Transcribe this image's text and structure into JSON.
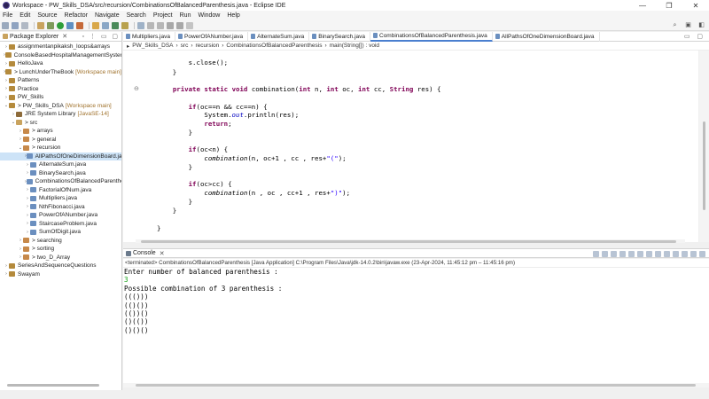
{
  "window": {
    "title": "Workspace - PW_Skills_DSA/src/recursion/CombinationsOfBalancedParenthesis.java - Eclipse IDE",
    "controls": [
      "—",
      "❐",
      "✕"
    ]
  },
  "menu": [
    "File",
    "Edit",
    "Source",
    "Refactor",
    "Navigate",
    "Search",
    "Project",
    "Run",
    "Window",
    "Help"
  ],
  "explorer": {
    "tab_label": "Package Explorer",
    "tree": [
      {
        "label": "assignmentanpikaksh_loops&arrays",
        "suffix": "",
        "arrow": "›",
        "icon": "project-icon"
      },
      {
        "label": "ConsoleBasedHospitalManagementSystem",
        "suffix": "",
        "arrow": "›",
        "icon": "project-icon"
      },
      {
        "label": "HelloJava",
        "suffix": "",
        "arrow": "›",
        "icon": "project-icon"
      },
      {
        "label": "> LunchUnderTheBook",
        "suffix": "[Workspace main]",
        "arrow": "›",
        "icon": "project-icon"
      },
      {
        "label": "Patterns",
        "suffix": "",
        "arrow": "›",
        "icon": "project-icon"
      },
      {
        "label": "Practice",
        "suffix": "",
        "arrow": "›",
        "icon": "project-icon"
      },
      {
        "label": "PW_Skills",
        "suffix": "",
        "arrow": "›",
        "icon": "project-icon"
      },
      {
        "label": "> PW_Skills_DSA",
        "suffix": "[Workspace main]",
        "arrow": "⌄",
        "icon": "project-icon"
      },
      {
        "label": "JRE System Library",
        "suffix": "[JavaSE-14]",
        "arrow": "›",
        "icon": "library-icon"
      },
      {
        "label": "> src",
        "suffix": "",
        "arrow": "⌄",
        "icon": "folder-icon"
      },
      {
        "label": "> arrays",
        "suffix": "",
        "arrow": "›",
        "icon": "package-icon"
      },
      {
        "label": "> general",
        "suffix": "",
        "arrow": "›",
        "icon": "package-icon"
      },
      {
        "label": "> recursion",
        "suffix": "",
        "arrow": "⌄",
        "icon": "package-icon"
      },
      {
        "label": "AllPathsOfOneDimensionBoard.ja",
        "suffix": "",
        "arrow": "›",
        "icon": "java-file-icon",
        "selected": true
      },
      {
        "label": "AlternateSum.java",
        "suffix": "",
        "arrow": "›",
        "icon": "java-file-icon"
      },
      {
        "label": "BinarySearch.java",
        "suffix": "",
        "arrow": "›",
        "icon": "java-file-icon"
      },
      {
        "label": "CombinationsOfBalancedParenthe",
        "suffix": "",
        "arrow": "›",
        "icon": "java-file-icon"
      },
      {
        "label": "FactorialOfNum.java",
        "suffix": "",
        "arrow": "›",
        "icon": "java-file-icon"
      },
      {
        "label": "Multipliers.java",
        "suffix": "",
        "arrow": "›",
        "icon": "java-file-icon"
      },
      {
        "label": "NthFibonacci.java",
        "suffix": "",
        "arrow": "›",
        "icon": "java-file-icon"
      },
      {
        "label": "PowerOfANumber.java",
        "suffix": "",
        "arrow": "›",
        "icon": "java-file-icon"
      },
      {
        "label": "StaircaseProblem.java",
        "suffix": "",
        "arrow": "›",
        "icon": "java-file-icon"
      },
      {
        "label": "SumOfDigit.java",
        "suffix": "",
        "arrow": "›",
        "icon": "java-file-icon"
      },
      {
        "label": "> searching",
        "suffix": "",
        "arrow": "›",
        "icon": "package-icon"
      },
      {
        "label": "> sorting",
        "suffix": "",
        "arrow": "›",
        "icon": "package-icon"
      },
      {
        "label": "> two_D_Array",
        "suffix": "",
        "arrow": "›",
        "icon": "package-icon"
      },
      {
        "label": "SeriesAndSequenceQuestions",
        "suffix": "",
        "arrow": "›",
        "icon": "project-icon"
      },
      {
        "label": "Swayam",
        "suffix": "",
        "arrow": "›",
        "icon": "project-icon"
      }
    ]
  },
  "editor": {
    "tabs": [
      {
        "label": "Multipliers.java",
        "active": false
      },
      {
        "label": "PowerOfANumber.java",
        "active": false
      },
      {
        "label": "AlternateSum.java",
        "active": false
      },
      {
        "label": "BinarySearch.java",
        "active": false
      },
      {
        "label": "CombinationsOfBalancedParenthesis.java",
        "active": true
      },
      {
        "label": "AllPathsOfOneDimensionBoard.java",
        "active": false
      }
    ],
    "breadcrumb": [
      "PW_Skills_DSA",
      "src",
      "recursion",
      "CombinationsOfBalancedParenthesis",
      "main(String[]) : void"
    ],
    "code_lines": [
      "        s.close();",
      "    }",
      "",
      "    private static void combination(int n, int oc, int cc, String res) {",
      "",
      "        if(oc==n && cc==n) {",
      "            System.out.println(res);",
      "            return;",
      "        }",
      "",
      "        if(oc<n) {",
      "            combination(n, oc+1 , cc , res+\"(\");",
      "        }",
      "",
      "        if(oc>cc) {",
      "            combination(n , oc , cc+1 , res+\")\");",
      "        }",
      "    }",
      "",
      "}"
    ]
  },
  "console": {
    "tab_label": "Console",
    "status": "<terminated> CombinationsOfBalancedParenthesis [Java Application] C:\\Program Files\\Java\\jdk-14.0.2\\bin\\javaw.exe  (23-Apr-2024, 11:45:12 pm – 11:45:16 pm)",
    "lines": [
      {
        "text": "Enter number of balanced parenthesis :",
        "kind": "output"
      },
      {
        "text": "3",
        "kind": "input"
      },
      {
        "text": "Possible combination of 3 parenthesis :",
        "kind": "output"
      },
      {
        "text": "((()))",
        "kind": "output"
      },
      {
        "text": "(()())",
        "kind": "output"
      },
      {
        "text": "(())()",
        "kind": "output"
      },
      {
        "text": "()(())",
        "kind": "output"
      },
      {
        "text": "()()()",
        "kind": "output"
      }
    ]
  },
  "colors": {
    "keyword": "#7f0055",
    "string": "#2a00ff",
    "field": "#0000c0",
    "console_input": "#14a314",
    "selection": "#cde3f7"
  }
}
